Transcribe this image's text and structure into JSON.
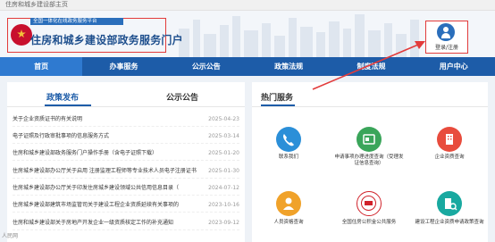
{
  "topbar": {
    "text": "住房和城乡建设部主页"
  },
  "header": {
    "logo_subtitle": "全国一体化在线政务服务平台",
    "logo_title": "住房和城乡建设部政务服务门户",
    "login_label": "登录/注册"
  },
  "nav": [
    "首页",
    "办事服务",
    "公示公告",
    "政策法规",
    "制度法规",
    "用户中心"
  ],
  "tabs": {
    "left": "政策发布",
    "right": "公示公告"
  },
  "news": [
    {
      "title": "关于企业资质证书的有关说明",
      "date": "2025-04-23"
    },
    {
      "title": "电子证照及行政审批事项的信息服务方式",
      "date": "2025-03-14"
    },
    {
      "title": "住房和城乡建设部政务服务门户操作手册（含电子证照下载）",
      "date": "2025-01-20"
    },
    {
      "title": "住房城乡建设部办公厅关于启用 注册监理工程师等专业技术人员电子注册证书的通知",
      "date": "2025-01-30"
    },
    {
      "title": "住房城乡建设部办公厅关于印发住房城乡建设领域公共信用信息目录（",
      "date": "2024-07-12"
    },
    {
      "title": "住房城乡建设部建筑市场监管司关于建设工程企业资质延续有关事项的",
      "date": "2023-10-16"
    },
    {
      "title": "住房和城乡建设部关于房地产开发企业一级资质核定工作的补充通知",
      "date": "2023-09-12"
    }
  ],
  "hot": {
    "title": "热门服务",
    "services": [
      {
        "label": "联系我们",
        "icon": "phone-icon",
        "color": "#2b8fd8"
      },
      {
        "label": "申请事项办理进度查询（受理发证信息查询）",
        "icon": "card-icon",
        "color": "#3aa55a"
      },
      {
        "label": "企业资质查询",
        "icon": "building-icon",
        "color": "#e84c3d"
      },
      {
        "label": "人员资格查询",
        "icon": "person-icon",
        "color": "#f0a22a"
      },
      {
        "label": "全国住房公积金公共服务",
        "icon": "fund-seal-icon",
        "color": "#d0222a"
      },
      {
        "label": "建设工程企业资质申请政策查询",
        "icon": "building-search-icon",
        "color": "#19a9a0"
      }
    ]
  },
  "watermark": "人民网"
}
